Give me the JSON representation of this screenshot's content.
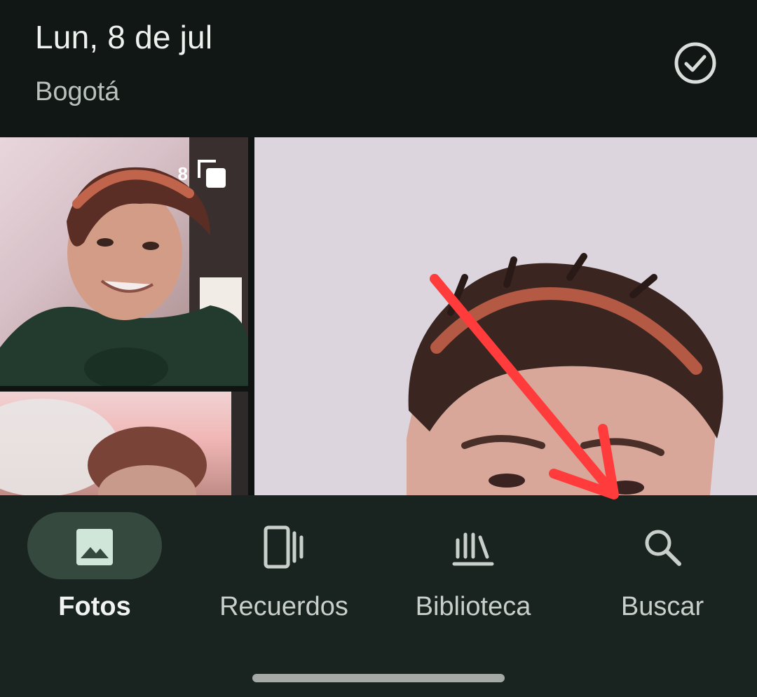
{
  "header": {
    "date": "Lun, 8 de jul",
    "location": "Bogotá"
  },
  "grid": {
    "photos": [
      {
        "stack_count": "8",
        "icon": "stack-icon"
      },
      {},
      {}
    ]
  },
  "nav": {
    "items": [
      {
        "label": "Fotos",
        "icon": "photos-icon",
        "active": true
      },
      {
        "label": "Recuerdos",
        "icon": "memories-icon",
        "active": false
      },
      {
        "label": "Biblioteca",
        "icon": "library-icon",
        "active": false
      },
      {
        "label": "Buscar",
        "icon": "search-icon",
        "active": false
      }
    ]
  },
  "colors": {
    "background": "#161d1a",
    "header": "#111715",
    "nav": "#19231f",
    "active_pill": "#35493f",
    "annotation_arrow": "#ff3b3b"
  }
}
